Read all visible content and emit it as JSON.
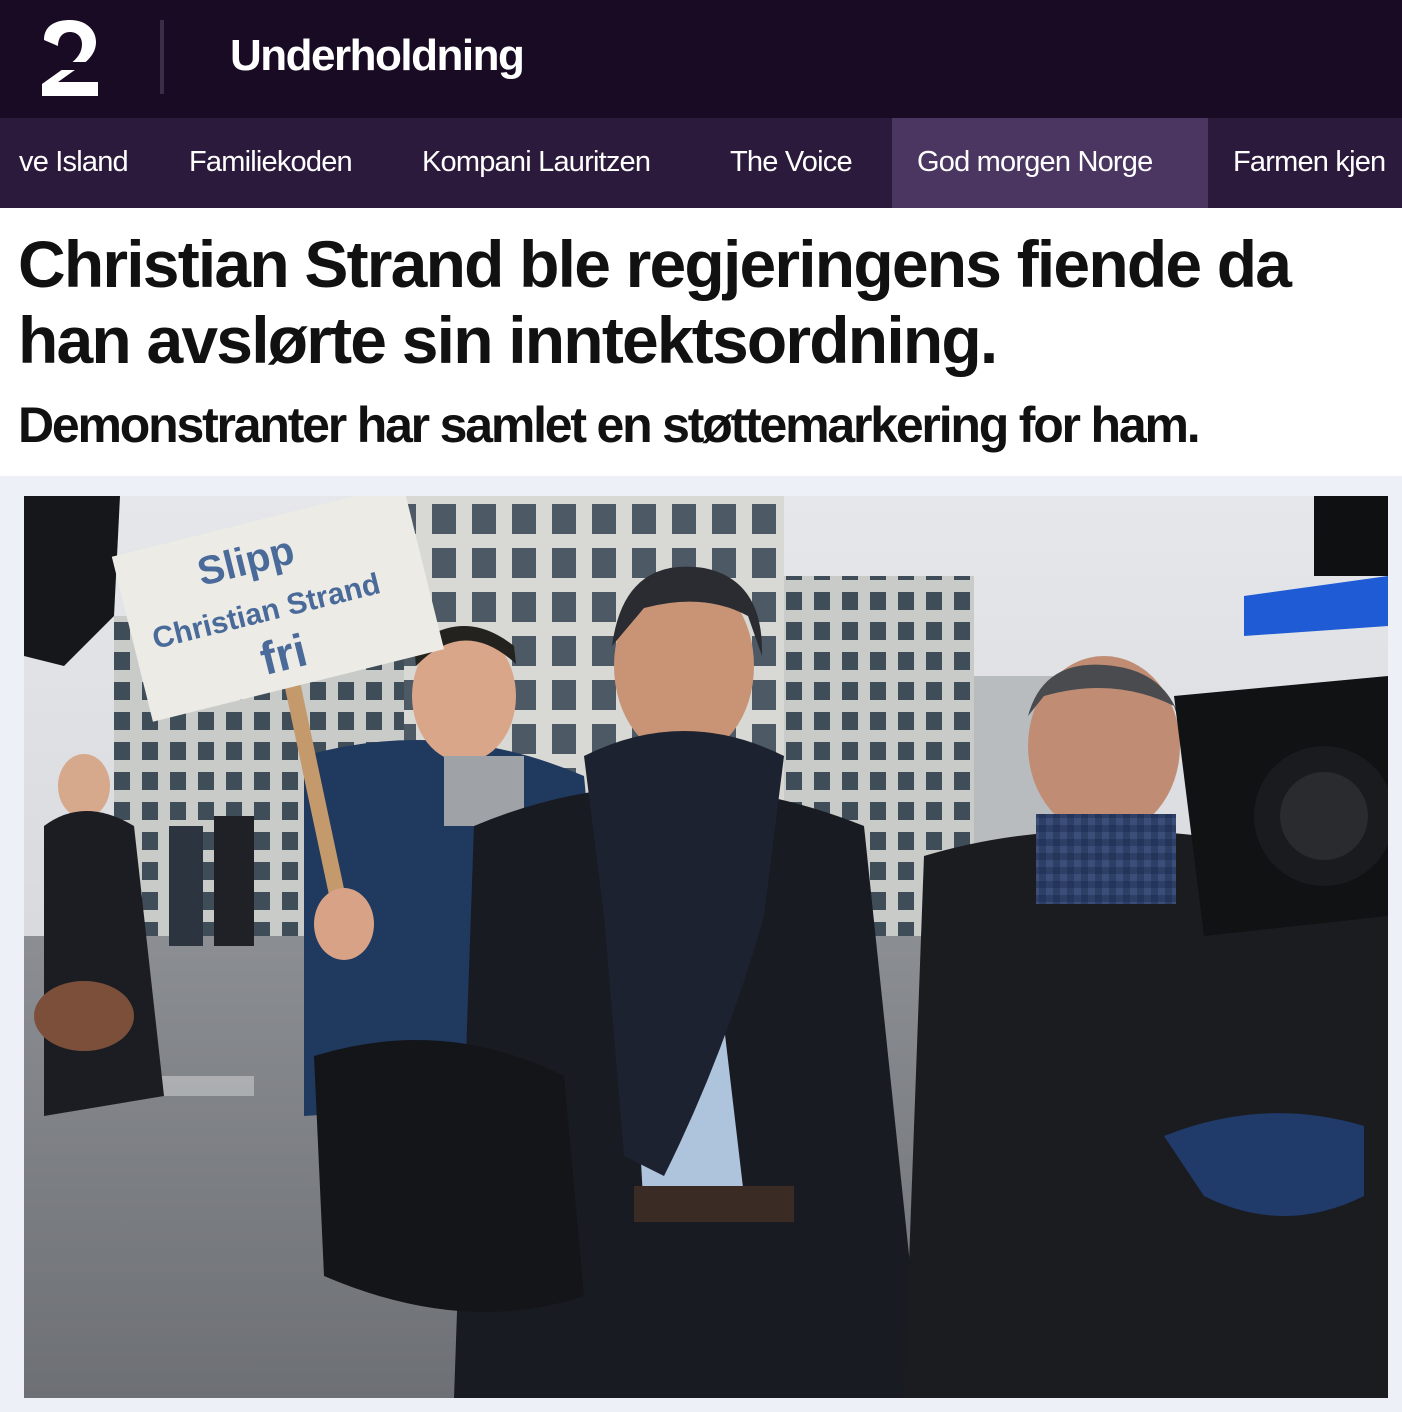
{
  "header": {
    "logo_label": "2",
    "section_title": "Underholdning"
  },
  "nav": {
    "items": [
      {
        "label": "ve Island",
        "active": false
      },
      {
        "label": "Familiekoden",
        "active": false
      },
      {
        "label": "Kompani Lauritzen",
        "active": false
      },
      {
        "label": "The Voice",
        "active": false
      },
      {
        "label": "God morgen Norge",
        "active": true
      },
      {
        "label": "Farmen kjen",
        "active": false
      }
    ]
  },
  "article": {
    "headline": "Christian Strand ble regjeringens fiende da han avslørte sin inntektsordning.",
    "subheadline": "Demonstranter har samlet en støttemarkering for ham."
  },
  "photo": {
    "sign_line_1": "Slipp",
    "sign_line_2": "Christian Strand",
    "sign_line_3": "fri"
  },
  "colors": {
    "top_bar": "#1a0b24",
    "nav_bar": "#2c1a3c",
    "nav_active": "#4b3661",
    "headline_text": "#111111"
  }
}
